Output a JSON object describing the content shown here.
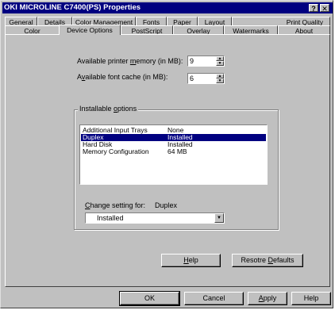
{
  "window": {
    "title": "OKI MICROLINE C7400(PS) Properties",
    "help_glyph": "?",
    "close_glyph": "✕"
  },
  "tabs_row1": [
    "General",
    "Details",
    "Color Management",
    "Fonts",
    "Paper",
    "Layout",
    "Print Quality"
  ],
  "tabs_row2": [
    "Color",
    "Device Options",
    "PostScript",
    "Overlay",
    "Watermarks",
    "About"
  ],
  "active_tab": "Device Options",
  "memory": {
    "label_pre": "Available printer ",
    "label_u": "m",
    "label_post": "emory (in MB):",
    "value": "9"
  },
  "font_cache": {
    "label_pre": "A",
    "label_u": "v",
    "label_post": "ailable font cache (in MB):",
    "value": "6"
  },
  "installable": {
    "title_pre": "Installable ",
    "title_u": "o",
    "title_post": "ptions",
    "rows": [
      {
        "name": "Additional Input Trays",
        "value": "None"
      },
      {
        "name": "Duplex",
        "value": "Installed"
      },
      {
        "name": "Hard Disk",
        "value": "Installed"
      },
      {
        "name": "Memory Configuration",
        "value": "64 MB"
      }
    ],
    "selected_row": 1
  },
  "change_setting": {
    "label_u": "C",
    "label_post": "hange setting for:",
    "target": "Duplex",
    "value": "Installed"
  },
  "buttons": {
    "help_u": "H",
    "help_post": "elp",
    "restore_pre": "Resotre ",
    "restore_u": "D",
    "restore_post": "efaults",
    "ok": "OK",
    "cancel": "Cancel",
    "apply_u": "A",
    "apply_post": "pply",
    "help2": "Help"
  },
  "colors": {
    "titlebar": "#000080",
    "face": "#c0c0c0",
    "selection": "#000080"
  }
}
